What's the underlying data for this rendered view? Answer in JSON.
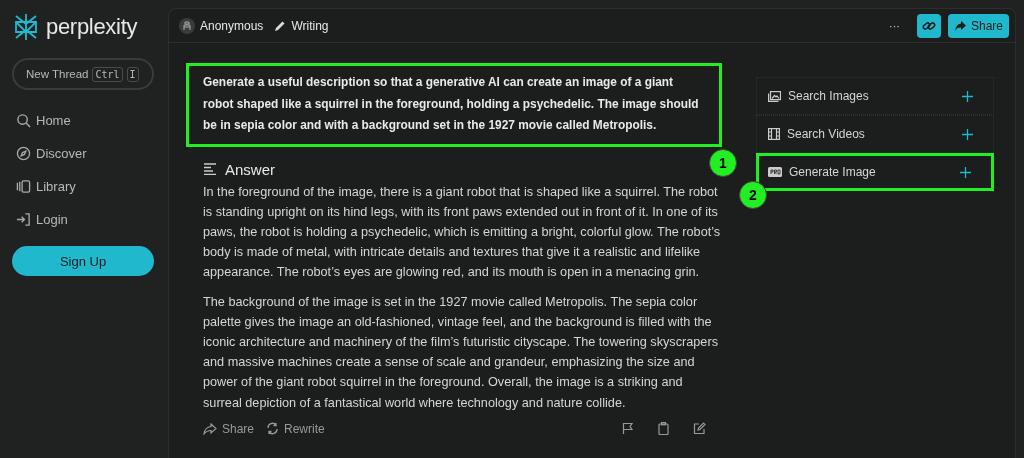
{
  "sidebar": {
    "logo": "perplexity",
    "new_thread": {
      "label": "New Thread",
      "keys": [
        "Ctrl",
        "I"
      ]
    },
    "nav": [
      {
        "label": "Home",
        "kind": "search"
      },
      {
        "label": "Discover",
        "kind": "compass"
      },
      {
        "label": "Library",
        "kind": "library"
      },
      {
        "label": "Login",
        "kind": "login"
      }
    ],
    "signup": "Sign Up"
  },
  "header": {
    "user": "Anonymous",
    "mode": "Writing",
    "more": "···",
    "share": "Share"
  },
  "question": {
    "text": "Generate a useful description so that a generative AI can create an image of a giant robot shaped like a squirrel in the foreground, holding a psychedelic. The image should be in sepia color and with a background set in the 1927 movie called Metropolis.",
    "highlighted": true,
    "callout": "1"
  },
  "answer": {
    "heading": "Answer",
    "paragraphs": [
      "In the foreground of the image, there is a giant robot that is shaped like a squirrel. The robot is standing upright on its hind legs, with its front paws extended out in front of it. In one of its paws, the robot is holding a psychedelic, which is emitting a bright, colorful glow. The robot’s body is made of metal, with intricate details and textures that give it a realistic and lifelike appearance. The robot’s eyes are glowing red, and its mouth is open in a menacing grin.",
      "The background of the image is set in the 1927 movie called Metropolis. The sepia color palette gives the image an old-fashioned, vintage feel, and the background is filled with the iconic architecture and machinery of the film’s futuristic cityscape. The towering skyscrapers and massive machines create a sense of scale and grandeur, emphasizing the size and power of the giant robot squirrel in the foreground. Overall, the image is a striking and surreal depiction of a fantastical world where technology and nature collide."
    ],
    "actions": [
      {
        "label": "Share",
        "kind": "share"
      },
      {
        "label": "Rewrite",
        "kind": "rewrite"
      }
    ]
  },
  "tools": {
    "items": [
      {
        "label": "Search Images",
        "kind": "image",
        "highlighted": false
      },
      {
        "label": "Search Videos",
        "kind": "video",
        "highlighted": false
      },
      {
        "label": "Generate Image",
        "kind": "pro",
        "highlighted": true
      }
    ],
    "callout": "2"
  }
}
